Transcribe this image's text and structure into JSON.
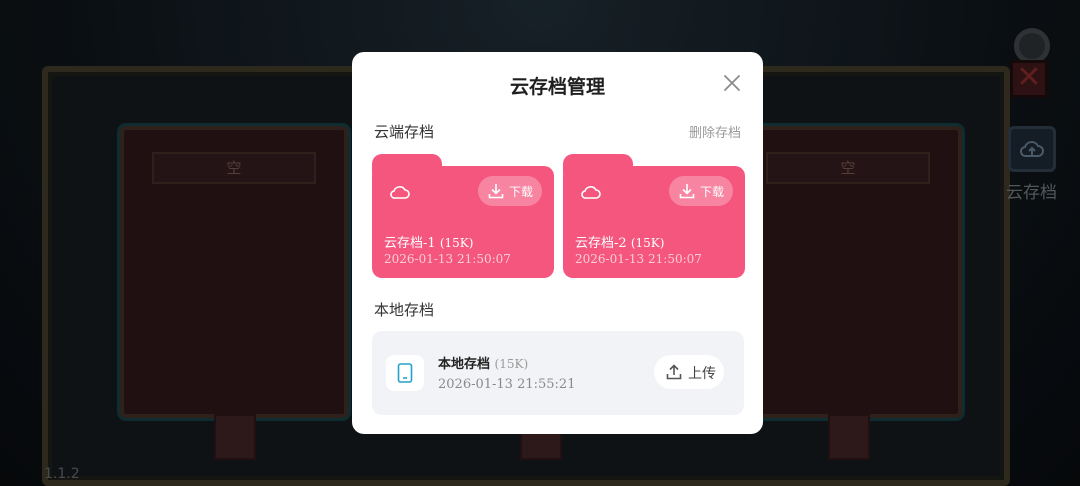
{
  "background": {
    "slot_left_label": "空",
    "slot_right_label": "空",
    "cloud_save_label": "云存档",
    "version": "1.1.2"
  },
  "dialog": {
    "title": "云存档管理",
    "cloud_section_title": "云端存档",
    "delete_label": "删除存档",
    "cloud_saves": [
      {
        "name": "云存档-1",
        "size": "(15K)",
        "time": "2026-01-13 21:50:07",
        "download_label": "下载"
      },
      {
        "name": "云存档-2",
        "size": "(15K)",
        "time": "2026-01-13 21:50:07",
        "download_label": "下载"
      }
    ],
    "local_section_title": "本地存档",
    "local_save": {
      "name": "本地存档",
      "size": "(15K)",
      "time": "2026-01-13 21:55:21",
      "upload_label": "上传"
    }
  },
  "colors": {
    "card_pink": "#f4567e",
    "device_icon": "#23a3c9"
  },
  "icons": [
    "settings-icon",
    "close-icon",
    "cloud-upload-icon",
    "cloud-icon",
    "download-icon",
    "tablet-icon",
    "upload-icon"
  ]
}
